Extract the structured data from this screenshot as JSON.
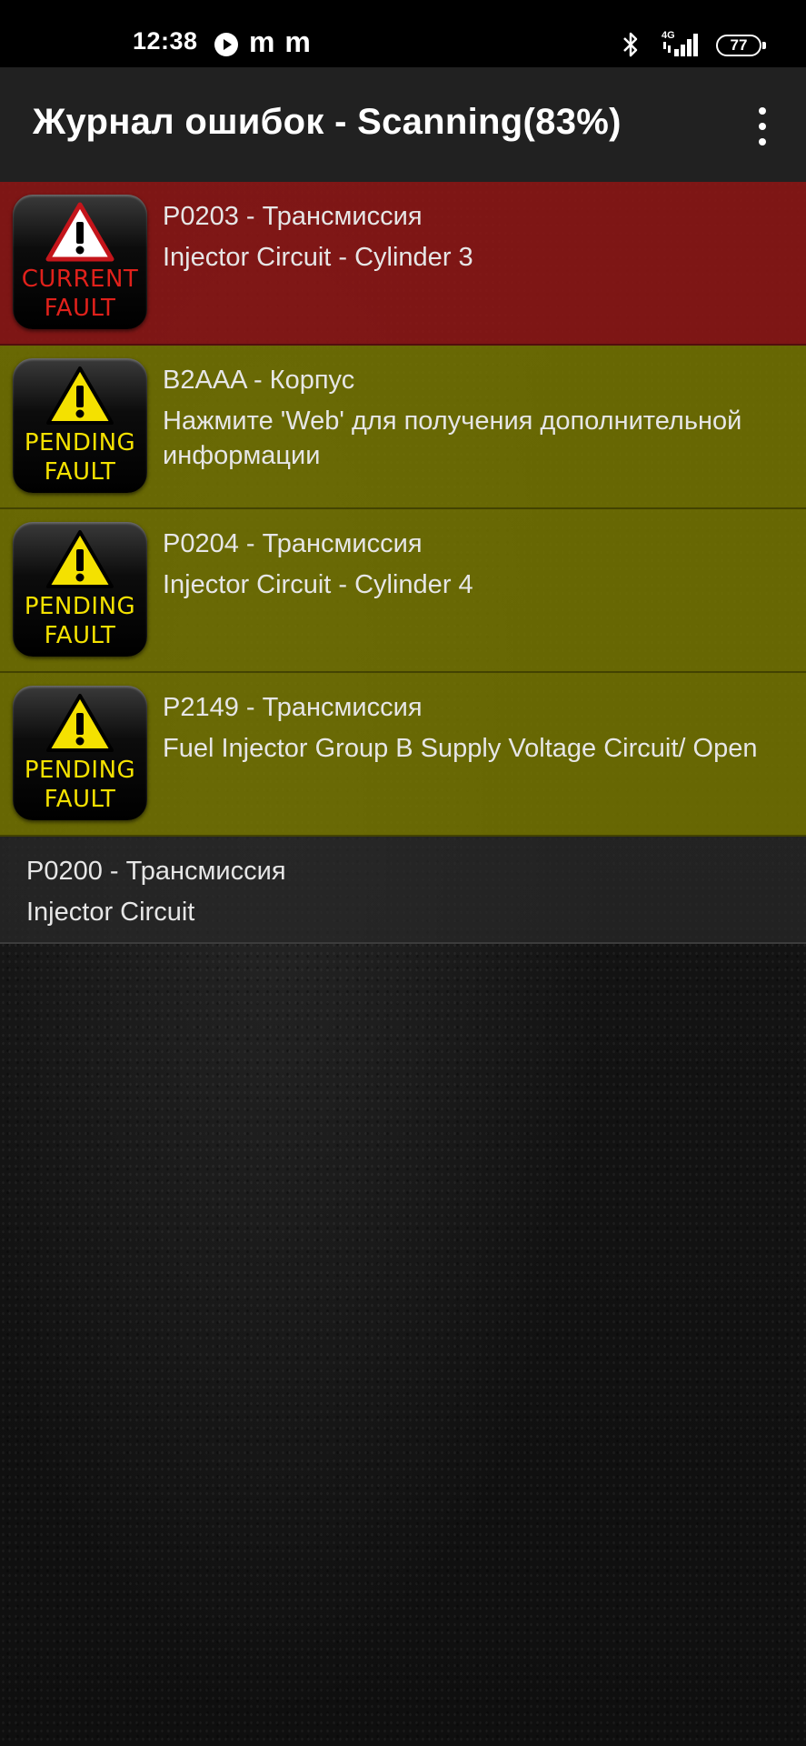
{
  "status_bar": {
    "time": "12:38",
    "notifications": "m m",
    "network": "4G",
    "battery": "77"
  },
  "app_bar": {
    "title": "Журнал ошибок - Scanning(83%)",
    "menu_icon": "overflow-vertical-icon"
  },
  "faults": [
    {
      "status": "current",
      "badge_line1": "CURRENT",
      "badge_line2": "FAULT",
      "code_line": "P0203 - Трансмиссия",
      "description": "Injector Circuit - Cylinder 3",
      "row_color": "#8c1614",
      "badge_text_color": "#e0211b"
    },
    {
      "status": "pending",
      "badge_line1": "PENDING",
      "badge_line2": "FAULT",
      "code_line": "B2AAA - Корпус",
      "description": "Нажмите 'Web' для получения дополнительной информации",
      "row_color": "#767600",
      "badge_text_color": "#f4e100"
    },
    {
      "status": "pending",
      "badge_line1": "PENDING",
      "badge_line2": "FAULT",
      "code_line": "P0204 - Трансмиссия",
      "description": "Injector Circuit - Cylinder 4",
      "row_color": "#767600",
      "badge_text_color": "#f4e100"
    },
    {
      "status": "pending",
      "badge_line1": "PENDING",
      "badge_line2": "FAULT",
      "code_line": "P2149 - Трансмиссия",
      "description": "Fuel Injector Group B Supply Voltage Circuit/ Open",
      "row_color": "#767600",
      "badge_text_color": "#f4e100"
    },
    {
      "status": "none",
      "code_line": "P0200 - Трансмиссия",
      "description": "Injector Circuit"
    }
  ]
}
